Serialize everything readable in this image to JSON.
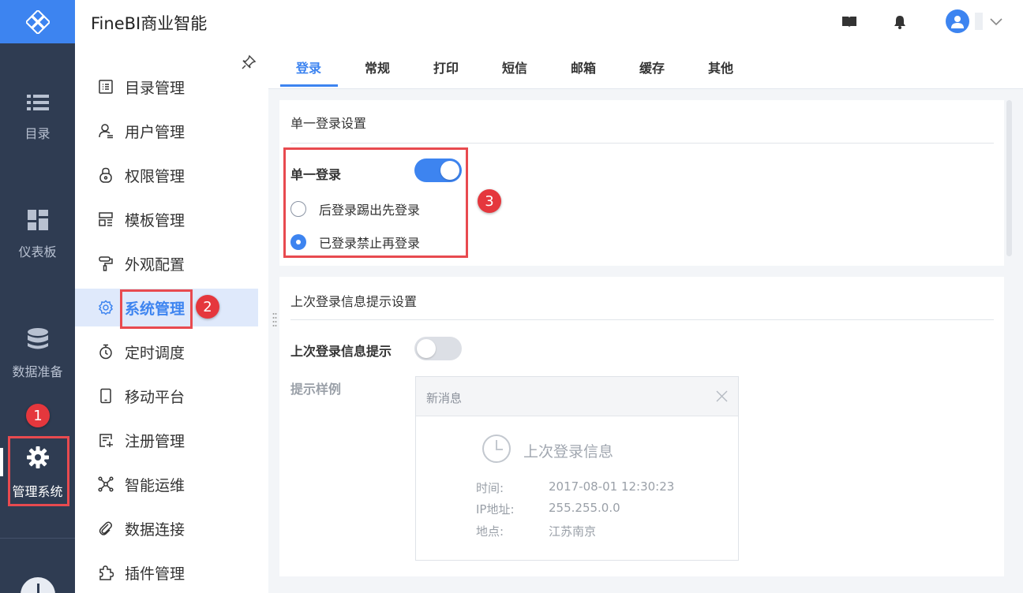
{
  "app": {
    "title": "FineBI商业智能"
  },
  "rail": {
    "items": [
      {
        "label": "目录",
        "icon": "list-icon"
      },
      {
        "label": "仪表板",
        "icon": "dashboard-icon"
      },
      {
        "label": "数据准备",
        "icon": "database-icon"
      },
      {
        "label": "管理系统",
        "icon": "gear-icon",
        "active": true
      }
    ]
  },
  "header": {
    "icons": [
      "book-icon",
      "bell-icon",
      "avatar-icon",
      "chevron-down-icon"
    ]
  },
  "subnav": {
    "items": [
      {
        "label": "目录管理",
        "icon": "catalog-icon"
      },
      {
        "label": "用户管理",
        "icon": "user-icon"
      },
      {
        "label": "权限管理",
        "icon": "lock-icon"
      },
      {
        "label": "模板管理",
        "icon": "template-icon"
      },
      {
        "label": "外观配置",
        "icon": "paint-roller-icon"
      },
      {
        "label": "系统管理",
        "icon": "gear-icon",
        "active": true
      },
      {
        "label": "定时调度",
        "icon": "timer-icon"
      },
      {
        "label": "移动平台",
        "icon": "mobile-icon"
      },
      {
        "label": "注册管理",
        "icon": "register-icon"
      },
      {
        "label": "智能运维",
        "icon": "network-icon"
      },
      {
        "label": "数据连接",
        "icon": "paperclip-icon"
      },
      {
        "label": "插件管理",
        "icon": "puzzle-icon"
      }
    ]
  },
  "tabs": [
    {
      "label": "登录",
      "active": true
    },
    {
      "label": "常规"
    },
    {
      "label": "打印"
    },
    {
      "label": "短信"
    },
    {
      "label": "邮箱"
    },
    {
      "label": "缓存"
    },
    {
      "label": "其他"
    }
  ],
  "sso": {
    "section_title": "单一登录设置",
    "toggle_label": "单一登录",
    "toggle_on": true,
    "options": [
      {
        "label": "后登录踢出先登录",
        "checked": false
      },
      {
        "label": "已登录禁止再登录",
        "checked": true
      }
    ]
  },
  "last_login": {
    "section_title": "上次登录信息提示设置",
    "toggle_label": "上次登录信息提示",
    "toggle_on": false,
    "sample_label": "提示样例",
    "card": {
      "header": "新消息",
      "title": "上次登录信息",
      "rows": [
        {
          "key": "时间:",
          "value": "2017-08-01 12:30:23"
        },
        {
          "key": "IP地址:",
          "value": "255.255.0.0"
        },
        {
          "key": "地点:",
          "value": "江苏南京"
        }
      ]
    }
  },
  "annotations": {
    "badge1": "1",
    "badge2": "2",
    "badge3": "3"
  },
  "colors": {
    "accent": "#3d84f0",
    "rail_bg": "#2f3c52",
    "annotation_red": "#e5373d"
  }
}
